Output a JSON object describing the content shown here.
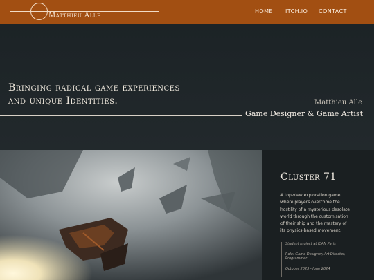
{
  "header": {
    "site_name": "Matthieu Alle",
    "nav": [
      {
        "label": "HOME"
      },
      {
        "label": "ITCH.IO"
      },
      {
        "label": "CONTACT"
      }
    ],
    "bar_color": "#a24f12"
  },
  "hero": {
    "tagline_line1": "Bringing radical game experiences",
    "tagline_line2": "and unique Identities.",
    "name": "Matthieu Alle",
    "role": "Game Designer & Game Artist"
  },
  "project": {
    "title": "Cluster 71",
    "description": "A top-view exploration game where players overcome the hostility of a mysterious desolate world through the customisation of their ship and the mastery of its physics-based movement.",
    "details": [
      "Student project at ICAN Paris",
      "Role: Game Designer, Art Director, Programmer",
      "October 2023 - June 2024"
    ]
  }
}
